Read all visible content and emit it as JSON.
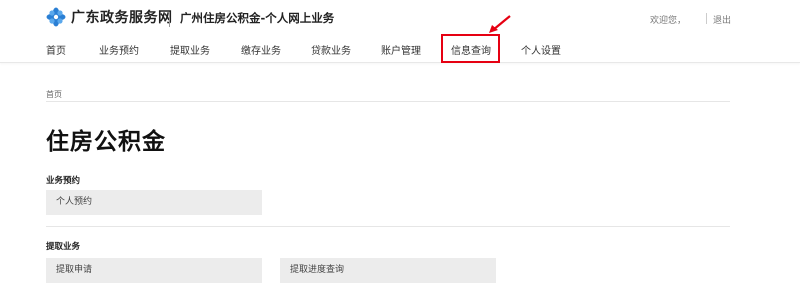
{
  "header": {
    "logo_text": "广东政务服务网",
    "site_title": "广州住房公积金-个人网上业务",
    "welcome": "欢迎您，",
    "logout": "退出"
  },
  "nav": {
    "items": [
      "首页",
      "业务预约",
      "提取业务",
      "缴存业务",
      "贷款业务",
      "账户管理",
      "信息查询",
      "个人设置"
    ],
    "highlighted": "信息查询"
  },
  "breadcrumb": "首页",
  "page_title": "住房公积金",
  "sections": [
    {
      "title": "业务预约",
      "cards": [
        "个人预约"
      ]
    },
    {
      "title": "提取业务",
      "cards": [
        "提取申请",
        "提取进度查询"
      ]
    }
  ],
  "colors": {
    "highlight": "#e60012",
    "logo_blue": "#2a7fd4",
    "card_bg": "#ececec"
  }
}
